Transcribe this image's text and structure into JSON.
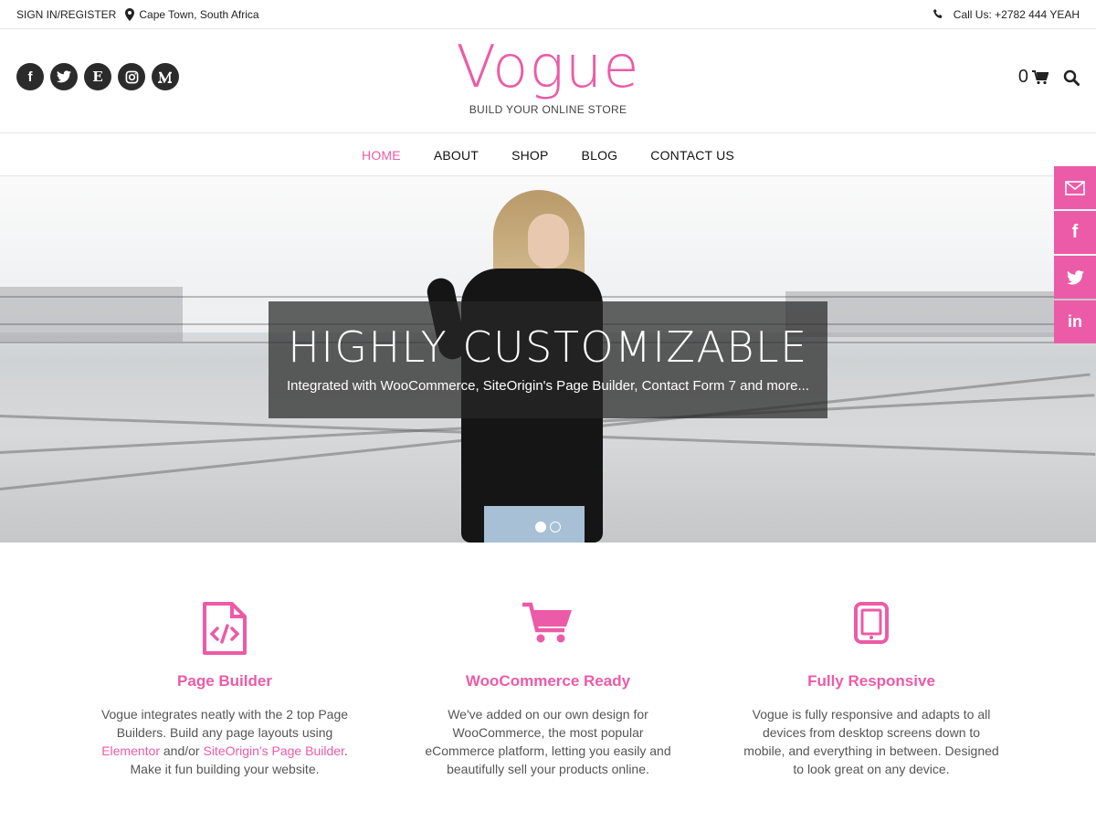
{
  "topbar": {
    "signin": "SIGN IN/REGISTER",
    "location": "Cape Town, South Africa",
    "phone": "Call Us: +2782 444 YEAH"
  },
  "header": {
    "logo": "Vogue",
    "tagline": "BUILD YOUR ONLINE STORE",
    "cart_count": "0",
    "social_icons": [
      "facebook-icon",
      "twitter-icon",
      "etsy-icon",
      "instagram-icon",
      "medium-icon"
    ]
  },
  "nav": {
    "items": [
      "HOME",
      "ABOUT",
      "SHOP",
      "BLOG",
      "CONTACT US"
    ],
    "active": "HOME"
  },
  "hero": {
    "title": "HIGHLY CUSTOMIZABLE",
    "subtitle": "Integrated with WooCommerce, SiteOrigin's Page Builder, Contact Form 7 and more..."
  },
  "share": [
    "email-icon",
    "facebook-icon",
    "twitter-icon",
    "linkedin-icon"
  ],
  "features": [
    {
      "title": "Page Builder",
      "text_parts": [
        "Vogue integrates neatly with the 2 top Page Builders. Build any page layouts using ",
        "Elementor",
        " and/or ",
        "SiteOrigin's Page Builder",
        ". Make it fun building your website."
      ]
    },
    {
      "title": "WooCommerce Ready",
      "text": "We've added on our own design for WooCommerce, the most popular eCommerce platform, letting you easily and beautifully sell your products online."
    },
    {
      "title": "Fully Responsive",
      "text": "Vogue is fully responsive and adapts to all devices from desktop screens down to mobile, and everything in between. Designed to look great on any device."
    }
  ],
  "colors": {
    "accent": "#ec5ba7",
    "dark": "#2b2b2b"
  }
}
